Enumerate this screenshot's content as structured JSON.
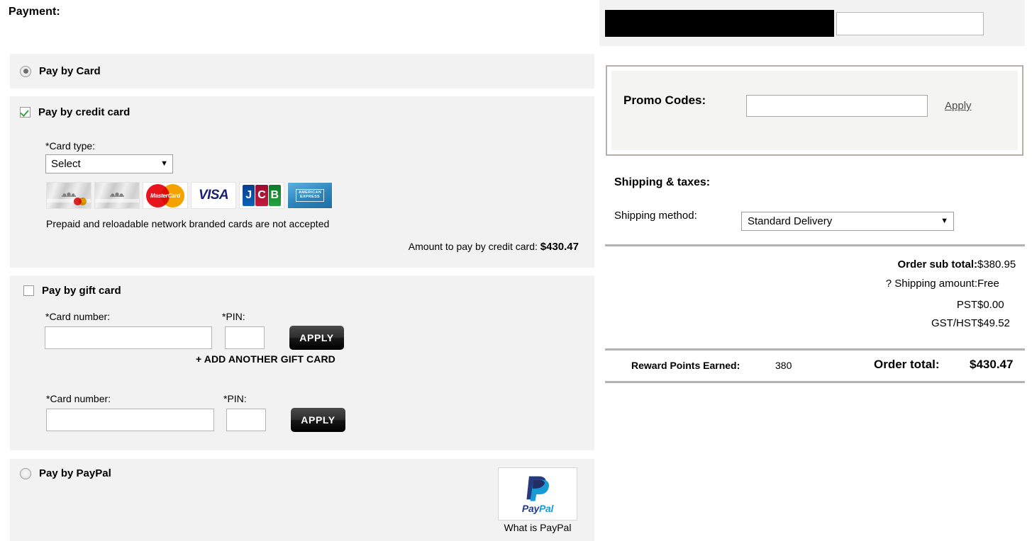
{
  "payment": {
    "heading": "Payment:",
    "pay_by_card": {
      "label": "Pay by Card",
      "selected": true
    },
    "credit_card": {
      "label": "Pay by credit card",
      "checked": true,
      "card_type_label": "*Card type:",
      "card_type_value": "Select",
      "caret": "▼",
      "accepted_logos": [
        "store-silver-card-mastercard-icon",
        "store-silver-card-icon",
        "mastercard-icon",
        "visa-icon",
        "jcb-icon",
        "american-express-icon"
      ],
      "mastercard_text": "MasterCard",
      "visa_text": "VISA",
      "jcb_letters": [
        "J",
        "C",
        "B"
      ],
      "amex_line1": "AMERICAN",
      "amex_line2": "EXPRESS",
      "prepaid_note": "Prepaid and reloadable network branded cards are not accepted",
      "amount_label": "Amount to pay by credit card:",
      "amount_value": "$430.47"
    },
    "gift_card": {
      "label": "Pay by gift card",
      "checked": false,
      "card_number_label": "*Card number:",
      "pin_label": "*PIN:",
      "card_number_value": "",
      "pin_value": "",
      "apply_label": "APPLY",
      "add_another_label": "+ ADD ANOTHER GIFT CARD"
    },
    "paypal": {
      "label": "Pay by PayPal",
      "selected": false,
      "logo_word_part1": "Pay",
      "logo_word_part2": "Pal",
      "caption": "What is PayPal"
    }
  },
  "summary": {
    "top_bar": {
      "redacted_block": "",
      "input_value": ""
    },
    "promo": {
      "label": "Promo Codes:",
      "input_value": "",
      "placeholder": "",
      "apply_label": "Apply"
    },
    "shipping": {
      "title": "Shipping & taxes:",
      "method_label": "Shipping method:",
      "method_value": "Standard Delivery",
      "caret": "▼"
    },
    "totals": [
      {
        "label": "Order sub total:",
        "value": "$380.95"
      },
      {
        "label": "? Shipping amount:",
        "value": "Free"
      },
      {
        "label": "PST",
        "value": "$0.00"
      },
      {
        "label": "GST/HST",
        "value": "$49.52"
      }
    ],
    "reward_points_label": "Reward Points Earned:",
    "reward_points_value": "380",
    "order_total_label": "Order total:",
    "order_total_value": "$430.47"
  },
  "colors": {
    "panel_bg": "#f2f2f2",
    "promo_border": "#b6b0a6",
    "rule": "#b3b3b3",
    "checkbox_check": "#36a43a",
    "visa_blue": "#1a1f71",
    "paypal_dark": "#253b80",
    "paypal_light": "#179bd7"
  }
}
